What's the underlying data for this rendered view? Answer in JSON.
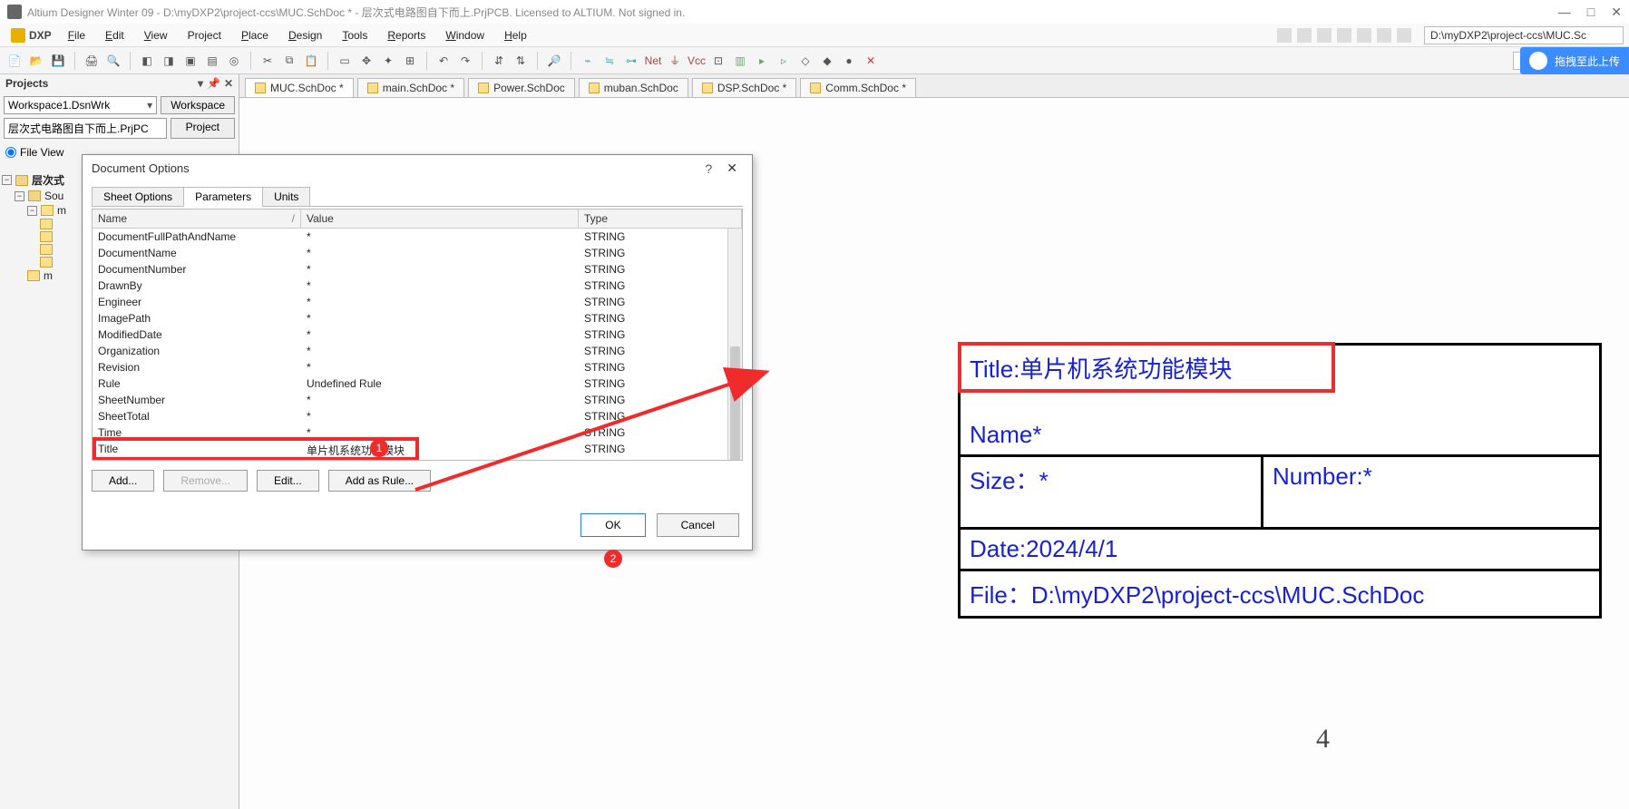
{
  "titlebar": {
    "text": "Altium Designer Winter 09 - D:\\myDXP2\\project-ccs\\MUC.SchDoc * - 层次式电路图自下而上.PrjPCB. Licensed to ALTIUM. Not signed in."
  },
  "menubar": {
    "dxp": "DXP",
    "items": [
      "File",
      "Edit",
      "View",
      "Project",
      "Place",
      "Design",
      "Tools",
      "Reports",
      "Window",
      "Help"
    ],
    "path": "D:\\myDXP2\\project-ccs\\MUC.Sc"
  },
  "blue_badge": {
    "text": "拖拽至此上传"
  },
  "projects": {
    "title": "Projects",
    "workspace_value": "Workspace1.DsnWrk",
    "workspace_btn": "Workspace",
    "project_value": "层次式电路图自下而上.PrjPC",
    "project_btn": "Project",
    "file_view": "File View",
    "tree": {
      "root": "层次式",
      "src": "Sou",
      "items": [
        "m",
        "",
        "",
        "",
        "",
        "m"
      ]
    }
  },
  "doc_tabs": [
    "MUC.SchDoc *",
    "main.SchDoc *",
    "Power.SchDoc",
    "muban.SchDoc",
    "DSP.SchDoc *",
    "Comm.SchDoc *"
  ],
  "dialog": {
    "title": "Document Options",
    "tabs": [
      "Sheet Options",
      "Parameters",
      "Units"
    ],
    "cols": [
      "Name",
      "Value",
      "Type"
    ],
    "rows": [
      {
        "name": "DocumentFullPathAndName",
        "value": "*",
        "type": "STRING"
      },
      {
        "name": "DocumentName",
        "value": "*",
        "type": "STRING"
      },
      {
        "name": "DocumentNumber",
        "value": "*",
        "type": "STRING"
      },
      {
        "name": "DrawnBy",
        "value": "*",
        "type": "STRING"
      },
      {
        "name": "Engineer",
        "value": "*",
        "type": "STRING"
      },
      {
        "name": "ImagePath",
        "value": "*",
        "type": "STRING"
      },
      {
        "name": "ModifiedDate",
        "value": "*",
        "type": "STRING"
      },
      {
        "name": "Organization",
        "value": "*",
        "type": "STRING"
      },
      {
        "name": "Revision",
        "value": "*",
        "type": "STRING"
      },
      {
        "name": "Rule",
        "value": "Undefined Rule",
        "type": "STRING"
      },
      {
        "name": "SheetNumber",
        "value": "*",
        "type": "STRING"
      },
      {
        "name": "SheetTotal",
        "value": "*",
        "type": "STRING"
      },
      {
        "name": "Time",
        "value": "*",
        "type": "STRING"
      },
      {
        "name": "Title",
        "value": "单片机系统功能模块",
        "type": "STRING"
      }
    ],
    "buttons": {
      "add": "Add...",
      "remove": "Remove...",
      "edit": "Edit...",
      "add_rule": "Add as Rule..."
    },
    "ok": "OK",
    "cancel": "Cancel"
  },
  "title_block": {
    "title_label": "Title:",
    "title_value": "单片机系统功能模块",
    "name": "Name*",
    "size": "Size：*",
    "number": "Number:*",
    "date": "Date:2024/4/1",
    "file": "File：D:\\myDXP2\\project-ccs\\MUC.SchDoc"
  },
  "page_number": "4",
  "badges": {
    "one": "1",
    "two": "2"
  }
}
